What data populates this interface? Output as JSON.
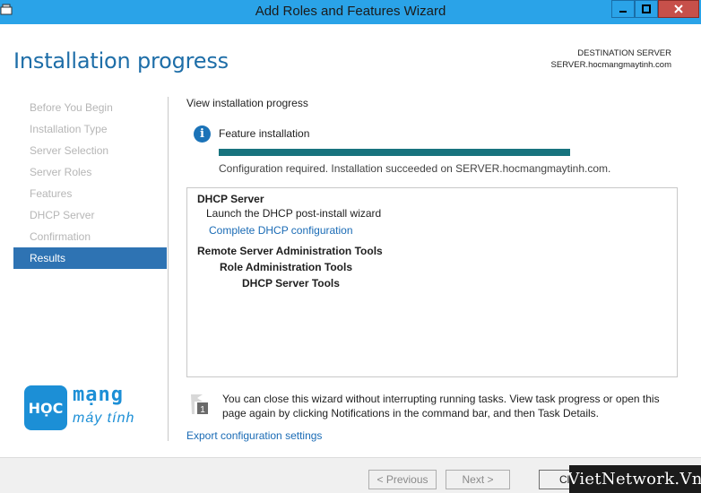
{
  "window": {
    "title": "Add Roles and Features Wizard",
    "minimize_icon": "minimize-icon",
    "maximize_icon": "maximize-icon",
    "close_icon": "close-icon"
  },
  "header": {
    "page_title": "Installation progress",
    "destination_label": "DESTINATION SERVER",
    "destination_value": "SERVER.hocmangmaytinh.com"
  },
  "nav": {
    "items": [
      {
        "label": "Before You Begin",
        "active": false
      },
      {
        "label": "Installation Type",
        "active": false
      },
      {
        "label": "Server Selection",
        "active": false
      },
      {
        "label": "Server Roles",
        "active": false
      },
      {
        "label": "Features",
        "active": false
      },
      {
        "label": "DHCP Server",
        "active": false
      },
      {
        "label": "Confirmation",
        "active": false
      },
      {
        "label": "Results",
        "active": true
      }
    ]
  },
  "logo": {
    "box_text": "HỌC",
    "line1": "mạng",
    "line2": "máy tính"
  },
  "main": {
    "section_label": "View installation progress",
    "feature_label": "Feature installation",
    "progress": 1.0,
    "status": "Configuration required. Installation succeeded on SERVER.hocmangmaytinh.com.",
    "results": {
      "dhcp_heading": "DHCP Server",
      "dhcp_launch": "Launch the DHCP post-install wizard",
      "dhcp_link": "Complete DHCP configuration",
      "rsat_heading": "Remote Server Administration Tools",
      "role_tools": "Role Administration Tools",
      "dhcp_tools": "DHCP Server Tools"
    },
    "note": "You can close this wizard without interrupting running tasks. View task progress or open this page again by clicking Notifications in the command bar, and then Task Details.",
    "note_badge": "1",
    "export_link": "Export configuration settings"
  },
  "footer": {
    "previous_label": "< Previous",
    "next_label": "Next >",
    "close_label": "Cl"
  },
  "watermark": "VietNetwork.Vn",
  "colors": {
    "titlebar": "#2aa3e8",
    "accent": "#1e6ea8",
    "nav_active": "#2e73b3",
    "progress": "#17737e",
    "link": "#1a6bb5"
  }
}
